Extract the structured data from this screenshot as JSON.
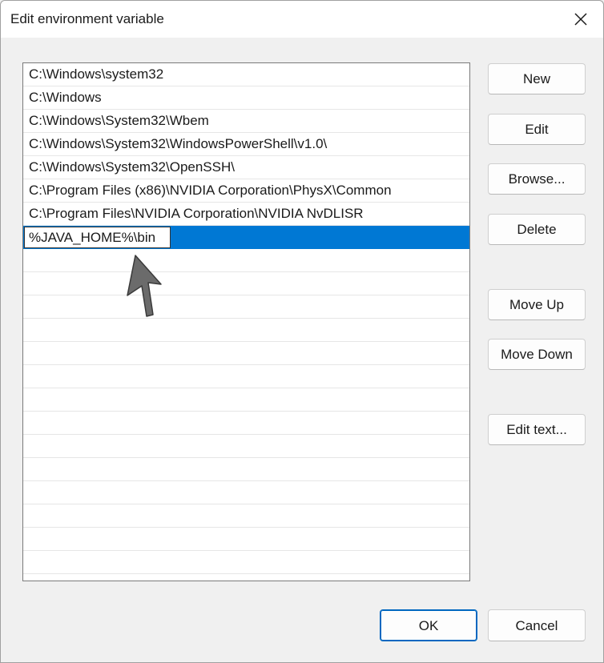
{
  "window": {
    "title": "Edit environment variable",
    "close_icon": "close-icon"
  },
  "list": {
    "items": [
      "C:\\Windows\\system32",
      "C:\\Windows",
      "C:\\Windows\\System32\\Wbem",
      "C:\\Windows\\System32\\WindowsPowerShell\\v1.0\\",
      "C:\\Windows\\System32\\OpenSSH\\",
      "C:\\Program Files (x86)\\NVIDIA Corporation\\PhysX\\Common",
      "C:\\Program Files\\NVIDIA Corporation\\NVIDIA NvDLISR"
    ],
    "editing_value": "%JAVA_HOME%\\bin",
    "selection_color": "#0078d4"
  },
  "buttons": {
    "new": "New",
    "edit": "Edit",
    "browse": "Browse...",
    "delete": "Delete",
    "move_up": "Move Up",
    "move_down": "Move Down",
    "edit_text": "Edit text...",
    "ok": "OK",
    "cancel": "Cancel"
  },
  "annotation": {
    "icon": "arrow-pointer-icon"
  }
}
